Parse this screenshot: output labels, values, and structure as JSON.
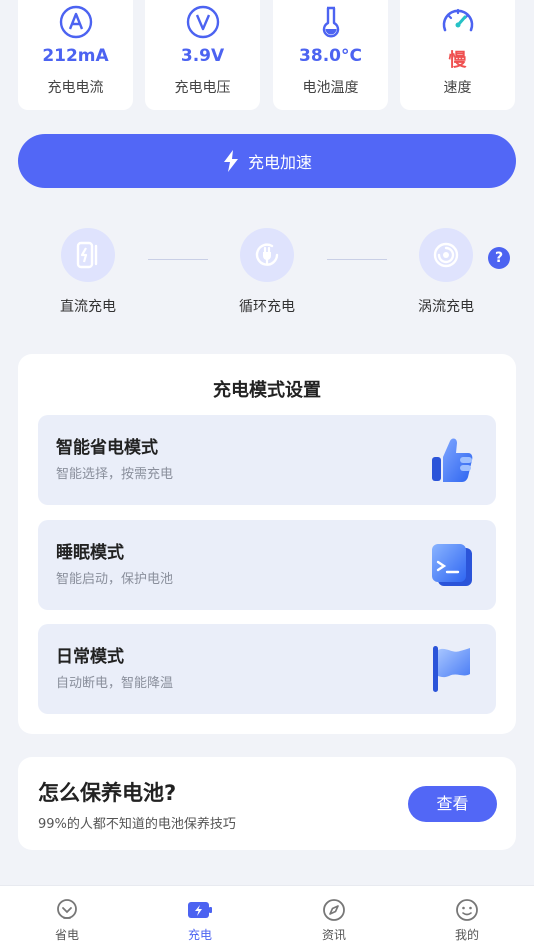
{
  "stats": [
    {
      "icon": "current-icon",
      "value": "212mA",
      "label": "充电电流"
    },
    {
      "icon": "voltage-icon",
      "value": "3.9V",
      "label": "充电电压"
    },
    {
      "icon": "thermometer-icon",
      "value": "38.0°C",
      "label": "电池温度"
    },
    {
      "icon": "speedometer-icon",
      "value": "慢",
      "label": "速度"
    }
  ],
  "accelerate": {
    "label": "充电加速",
    "icon": "lightning-icon"
  },
  "modes": [
    {
      "icon": "dc-charge-icon",
      "label": "直流充电"
    },
    {
      "icon": "cycle-charge-icon",
      "label": "循环充电"
    },
    {
      "icon": "vortex-charge-icon",
      "label": "涡流充电"
    }
  ],
  "help": {
    "symbol": "?"
  },
  "settings": {
    "title": "充电模式设置",
    "options": [
      {
        "title": "智能省电模式",
        "subtitle": "智能选择，按需充电",
        "icon": "thumbs-up-icon"
      },
      {
        "title": "睡眠模式",
        "subtitle": "智能启动，保护电池",
        "icon": "sleep-box-icon"
      },
      {
        "title": "日常模式",
        "subtitle": "自动断电，智能降温",
        "icon": "flag-icon"
      }
    ]
  },
  "tips": {
    "title": "怎么保养电池?",
    "subtitle": "99%的人都不知道的电池保养技巧",
    "button": "查看"
  },
  "nav": [
    {
      "icon": "bulb-icon",
      "label": "省电",
      "active": false
    },
    {
      "icon": "battery-charge-icon",
      "label": "充电",
      "active": true
    },
    {
      "icon": "compass-icon",
      "label": "资讯",
      "active": false
    },
    {
      "icon": "smile-icon",
      "label": "我的",
      "active": false
    }
  ],
  "colors": {
    "accent": "#5267f6",
    "slow": "#ef5050",
    "background": "#f1f3f8"
  }
}
